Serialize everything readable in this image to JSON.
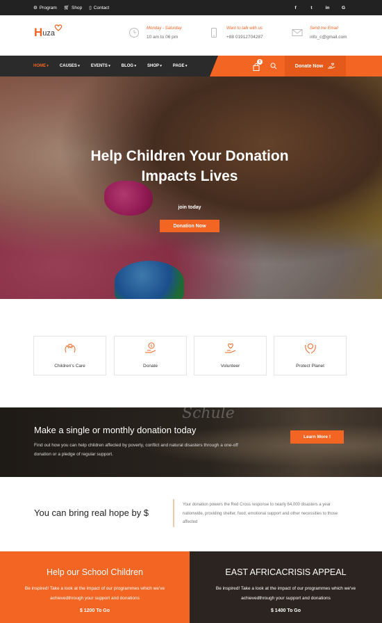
{
  "topbar": {
    "links": [
      {
        "icon": "gear-icon",
        "label": "Program"
      },
      {
        "icon": "cart-icon",
        "label": "Shop"
      },
      {
        "icon": "phone-icon",
        "label": "Contact"
      }
    ],
    "social": [
      {
        "icon": "facebook-icon",
        "glyph": "f"
      },
      {
        "icon": "twitter-icon",
        "glyph": "t"
      },
      {
        "icon": "linkedin-icon",
        "glyph": "in"
      },
      {
        "icon": "google-icon",
        "glyph": "G"
      }
    ]
  },
  "header": {
    "logo_h": "H",
    "logo_rest": "uza",
    "info": [
      {
        "icon": "clock-icon",
        "title": "Monday - Saturday",
        "value": "10 am to 06 pm"
      },
      {
        "icon": "mobile-icon",
        "title": "Want to talk with us",
        "value": "+88 01912704287"
      },
      {
        "icon": "envelope-icon",
        "title": "Send me Email",
        "value": "info_c@gmail.com"
      }
    ]
  },
  "nav": {
    "items": [
      "HOME",
      "CAUSES",
      "EVENTS",
      "BLOG",
      "SHOP",
      "PAGE"
    ],
    "active_index": 0,
    "cart_count": "0",
    "donate_label": "Donate Now"
  },
  "hero": {
    "title_line1": "Help Children Your Donation",
    "title_line2": "Impacts Lives",
    "subtitle": "join today",
    "button": "Donation Now"
  },
  "services": [
    {
      "icon": "care-hands-icon",
      "label": "Children's Care"
    },
    {
      "icon": "donate-coin-icon",
      "label": "Donate"
    },
    {
      "icon": "volunteer-heart-icon",
      "label": "Volunteer"
    },
    {
      "icon": "protect-planet-icon",
      "label": "Protect Planet"
    }
  ],
  "donation_strip": {
    "background_text": "Schule",
    "title": "Make a single or monthly donation today",
    "text": "Find out how you can help children affected by poverty, conflict and natural disasters through a one-off donation or a pledge of regular support.",
    "button": "Learn More !"
  },
  "hope": {
    "title": "You can bring real hope by $",
    "text": "Your donation powers the Red Cross response to nearly 64,000 disasters a year nationwide, providing shelter, food, emotional support and other necessities to those affected"
  },
  "panels": [
    {
      "title": "Help our School Children",
      "text": "Be inspired! Take a look at the impact of our programmes which we've achievedthrough your support and donations",
      "goal": "$ 1200 To Go"
    },
    {
      "title": "EAST AFRICACRISIS APPEAL",
      "text": "Be inspired! Take a look at the impact of our programmes which we've achievedthrough your support and donations",
      "goal": "$ 1400 To Go"
    }
  ],
  "colors": {
    "accent": "#f26522",
    "dark": "#2b2b2b",
    "panel_dark": "#2c2420"
  }
}
